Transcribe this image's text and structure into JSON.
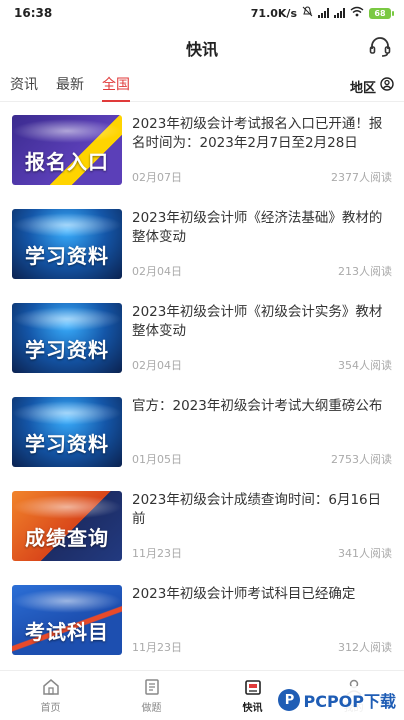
{
  "status_bar": {
    "time": "16:38",
    "network_speed": "71.0K/s",
    "battery": "68"
  },
  "header": {
    "title": "快讯"
  },
  "tabs": [
    {
      "label": "资讯",
      "active": false
    },
    {
      "label": "最新",
      "active": false
    },
    {
      "label": "全国",
      "active": true
    }
  ],
  "region": {
    "label": "地区"
  },
  "news": [
    {
      "thumb_text": "报名入口",
      "thumb_style": "t-purple",
      "title": "2023年初级会计考试报名入口已开通！报名时间为：2023年2月7日至2月28日",
      "date": "02月07日",
      "reads": "2377人阅读"
    },
    {
      "thumb_text": "学习资料",
      "thumb_style": "t-blue",
      "title": "2023年初级会计师《经济法基础》教材的整体变动",
      "date": "02月04日",
      "reads": "213人阅读"
    },
    {
      "thumb_text": "学习资料",
      "thumb_style": "t-blue",
      "title": "2023年初级会计师《初级会计实务》教材整体变动",
      "date": "02月04日",
      "reads": "354人阅读"
    },
    {
      "thumb_text": "学习资料",
      "thumb_style": "t-blue",
      "title": "官方：2023年初级会计考试大纲重磅公布",
      "date": "01月05日",
      "reads": "2753人阅读"
    },
    {
      "thumb_text": "成绩查询",
      "thumb_style": "t-orange",
      "title": "2023年初级会计成绩查询时间：6月16日前",
      "date": "11月23日",
      "reads": "341人阅读"
    },
    {
      "thumb_text": "考试科目",
      "thumb_style": "t-navy",
      "title": "2023年初级会计师考试科目已经确定",
      "date": "11月23日",
      "reads": "312人阅读"
    }
  ],
  "bottom_nav": [
    {
      "label": "首页",
      "icon": "home-icon",
      "active": false
    },
    {
      "label": "做题",
      "icon": "exercise-icon",
      "active": false
    },
    {
      "label": "快讯",
      "icon": "news-icon",
      "active": true
    },
    {
      "label": "我的",
      "icon": "profile-icon",
      "active": false
    }
  ],
  "watermark": {
    "text": "PCPOP下载"
  },
  "colors": {
    "accent": "#e03a3a",
    "text": "#333333",
    "meta": "#aaaaaa"
  }
}
